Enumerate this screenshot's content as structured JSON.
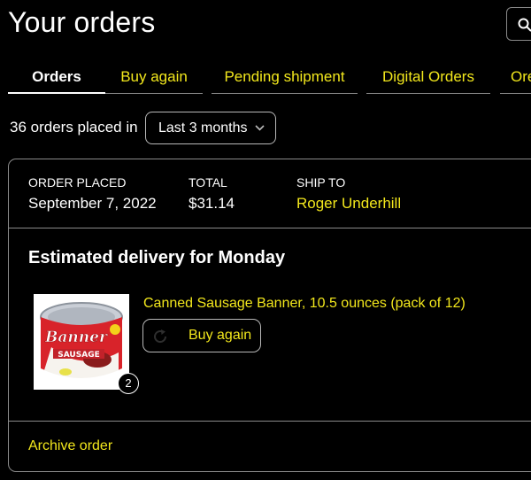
{
  "page": {
    "title": "Your orders"
  },
  "search": {
    "icon": "search-icon"
  },
  "tabs": [
    {
      "label": "Orders",
      "active": true
    },
    {
      "label": "Buy again"
    },
    {
      "label": "Pending shipment"
    },
    {
      "label": "Digital Orders"
    },
    {
      "label": "Ore"
    }
  ],
  "filter": {
    "count_text": "36 orders placed in",
    "selected": "Last 3 months"
  },
  "order": {
    "placed_label": "ORDER PLACED",
    "placed_value": "September 7, 2022",
    "total_label": "TOTAL",
    "total_value": "$31.14",
    "ship_label": "SHIP TO",
    "ship_value": "Roger Underhill",
    "delivery_title": "Estimated delivery for Monday",
    "item": {
      "title": "Canned Sausage Banner, 10.5 ounces (pack of 12)",
      "quantity": "2",
      "image_brand_text": "Banner",
      "image_sub_text": "SAUSAGE"
    },
    "buy_again_label": "Buy again",
    "archive_label": "Archive order"
  },
  "colors": {
    "background": "#000000",
    "text": "#ffffff",
    "link": "#f2e71c",
    "border": "#8a8a8a"
  }
}
